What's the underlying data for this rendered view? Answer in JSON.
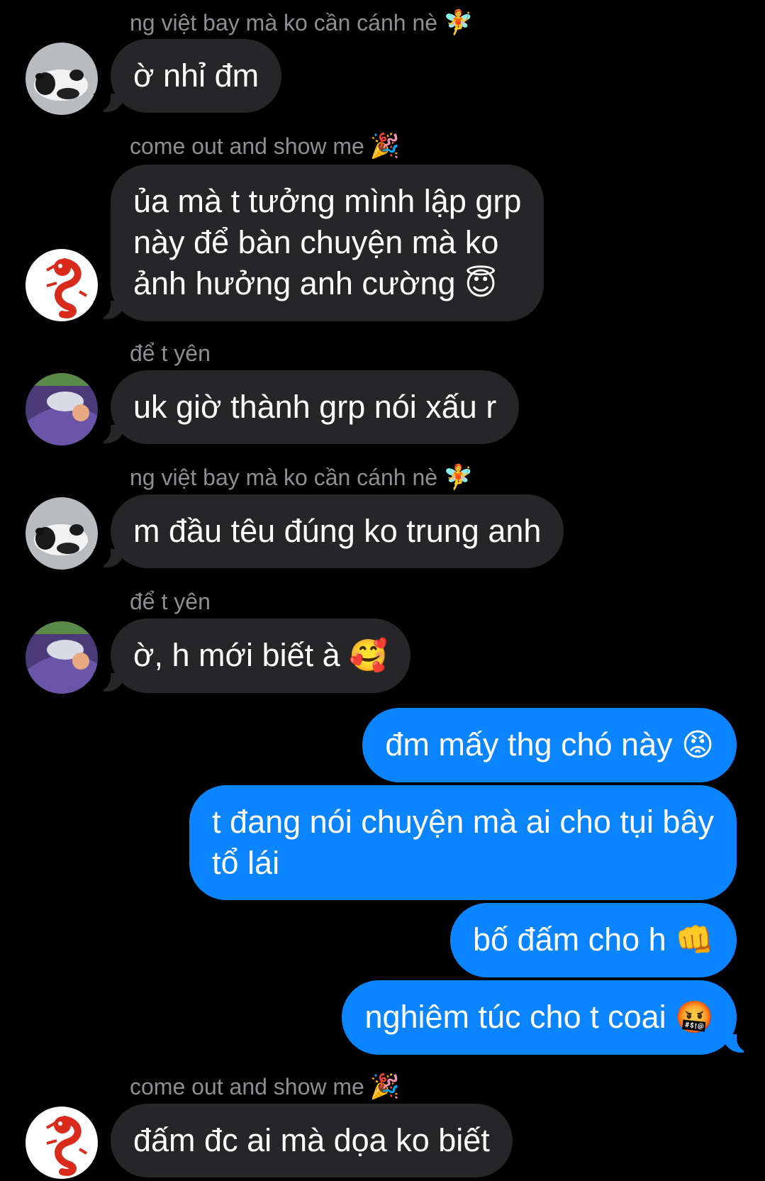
{
  "colors": {
    "background": "#000000",
    "incoming_bubble": "#262628",
    "outgoing_bubble": "#0a84ff",
    "sender_name": "#8e8e93",
    "text": "#ffffff"
  },
  "messages": [
    {
      "sender": "ng việt bay mà ko cần cánh nè",
      "sender_emoji": "🧚",
      "avatar": "panda-avatar",
      "text": "ờ nhỉ đm"
    },
    {
      "sender": "come out and show me",
      "sender_emoji": "🎉",
      "avatar": "dragon-avatar",
      "text": "ủa mà t tưởng mình lập grp\nnày để bàn chuyện mà ko\nảnh hưởng anh cường",
      "emoji": "😇"
    },
    {
      "sender": "để t yên",
      "avatar": "sleeping-avatar",
      "text": "uk giờ thành grp nói xấu r"
    },
    {
      "sender": "ng việt bay mà ko cần cánh nè",
      "sender_emoji": "🧚",
      "avatar": "panda-avatar",
      "text": "m đầu têu đúng ko trung anh"
    },
    {
      "sender": "để t yên",
      "avatar": "sleeping-avatar",
      "text": "ờ, h mới biết à",
      "emoji": "🥰"
    },
    {
      "direction": "outgoing",
      "text": "đm mấy thg chó này",
      "emoji": "😡"
    },
    {
      "direction": "outgoing",
      "text": "t đang nói chuyện mà ai cho tụi bây\ntổ lái"
    },
    {
      "direction": "outgoing",
      "text": "bố đấm cho h",
      "emoji": "👊"
    },
    {
      "direction": "outgoing",
      "text": "nghiêm túc cho t coai",
      "emoji": "🤬"
    },
    {
      "sender": "come out and show me",
      "sender_emoji": "🎉",
      "avatar": "dragon-avatar",
      "text": "đấm đc ai mà dọa ko biết"
    }
  ]
}
